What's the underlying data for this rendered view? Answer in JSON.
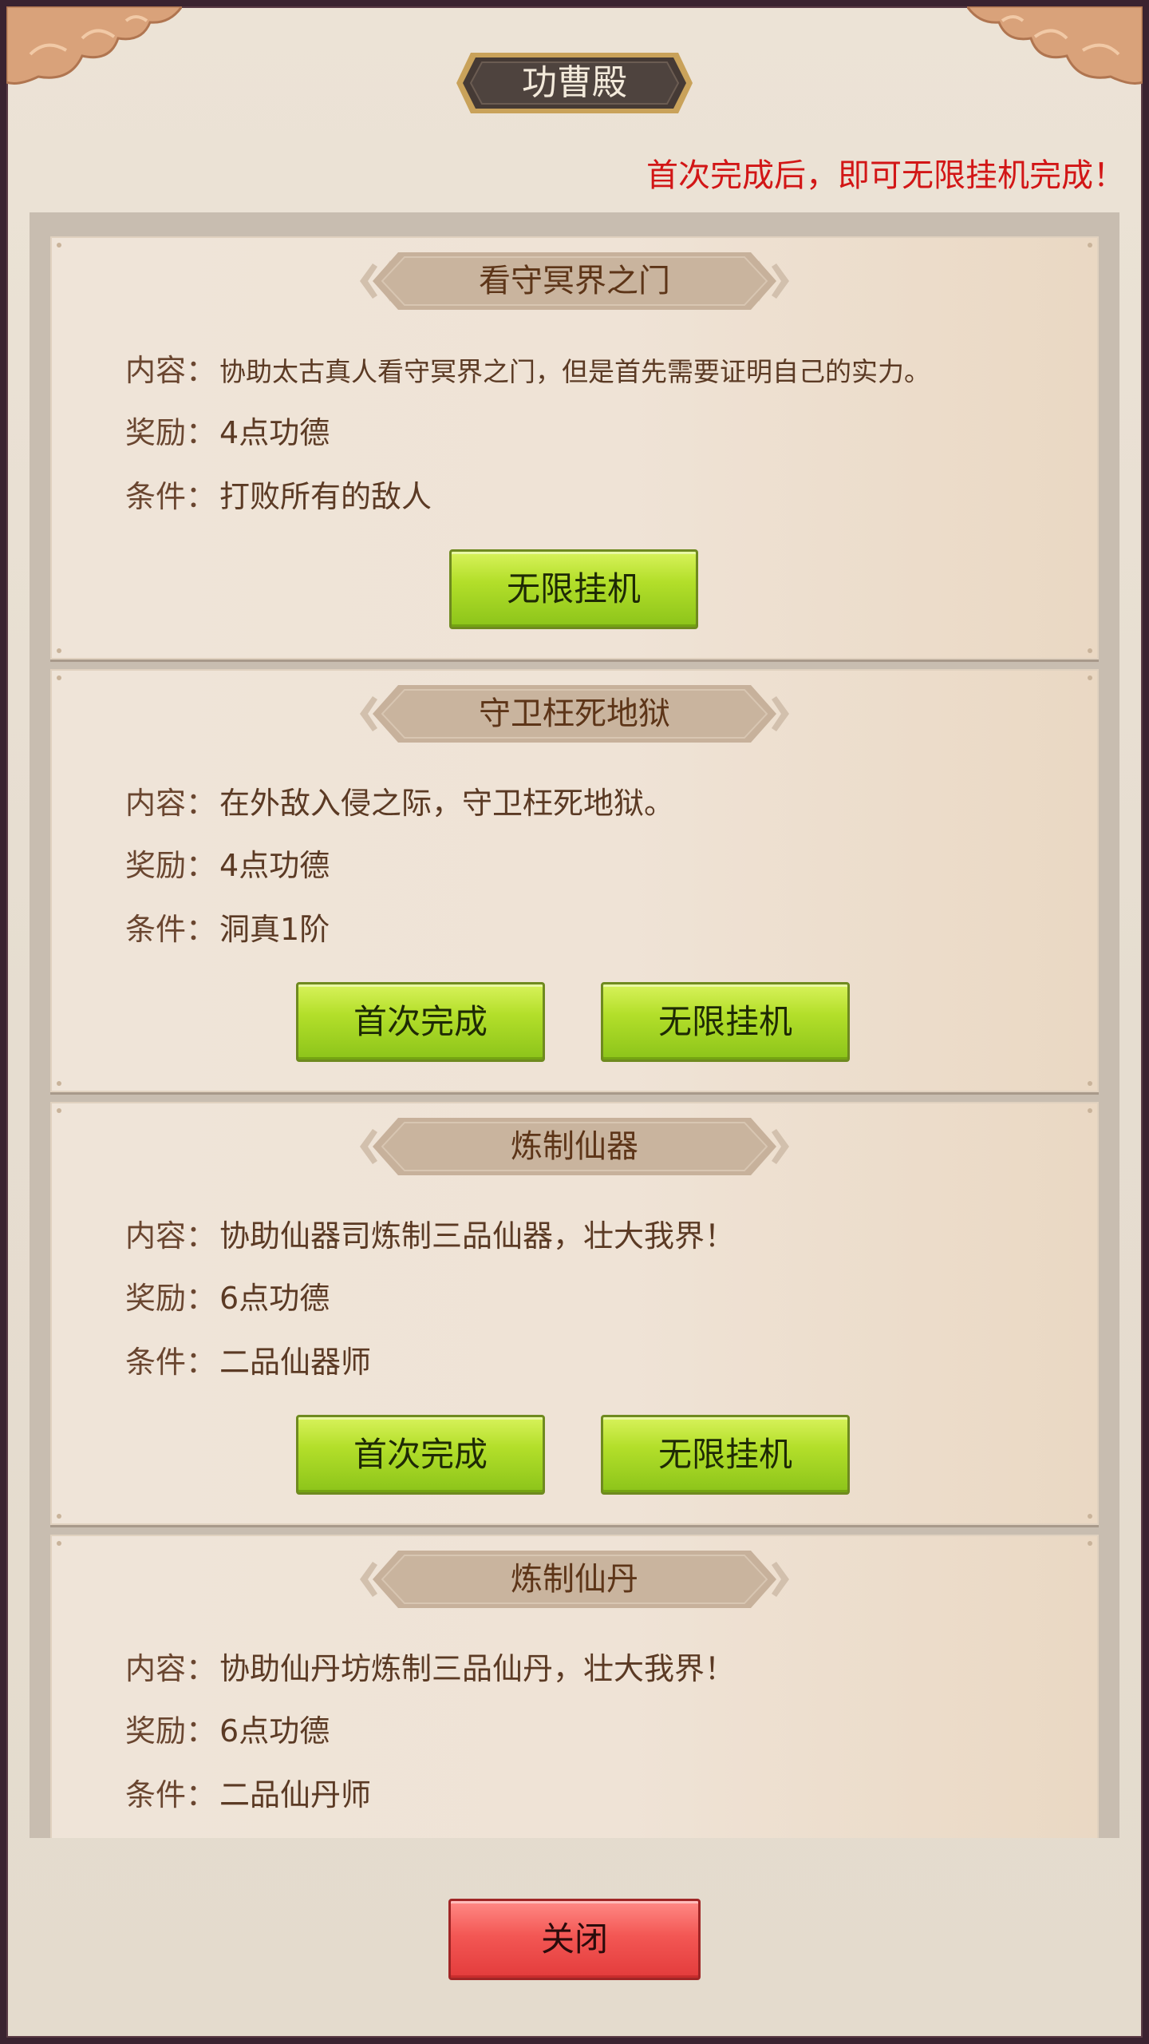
{
  "header": {
    "title": "功曹殿",
    "notice": "首次完成后，即可无限挂机完成！"
  },
  "labels": {
    "content": "内容：",
    "reward": "奖励：",
    "condition": "条件："
  },
  "tasks": [
    {
      "name": "看守冥界之门",
      "content": "协助太古真人看守冥界之门，但是首先需要证明自己的实力。",
      "reward": "4点功德",
      "condition": "打败所有的敌人",
      "buttons": [
        "无限挂机"
      ]
    },
    {
      "name": "守卫枉死地狱",
      "content": "在外敌入侵之际，守卫枉死地狱。",
      "reward": "4点功德",
      "condition": "洞真1阶",
      "buttons": [
        "首次完成",
        "无限挂机"
      ]
    },
    {
      "name": "炼制仙器",
      "content": "协助仙器司炼制三品仙器，壮大我界！",
      "reward": "6点功德",
      "condition": "二品仙器师",
      "buttons": [
        "首次完成",
        "无限挂机"
      ]
    },
    {
      "name": "炼制仙丹",
      "content": "协助仙丹坊炼制三品仙丹，壮大我界！",
      "reward": "6点功德",
      "condition": "二品仙丹师",
      "buttons": []
    }
  ],
  "footer": {
    "close_label": "关闭"
  },
  "colors": {
    "notice": "#d21616",
    "button_green": "#9fd424",
    "button_red": "#f04c4c",
    "banner": "#c8b39d"
  }
}
